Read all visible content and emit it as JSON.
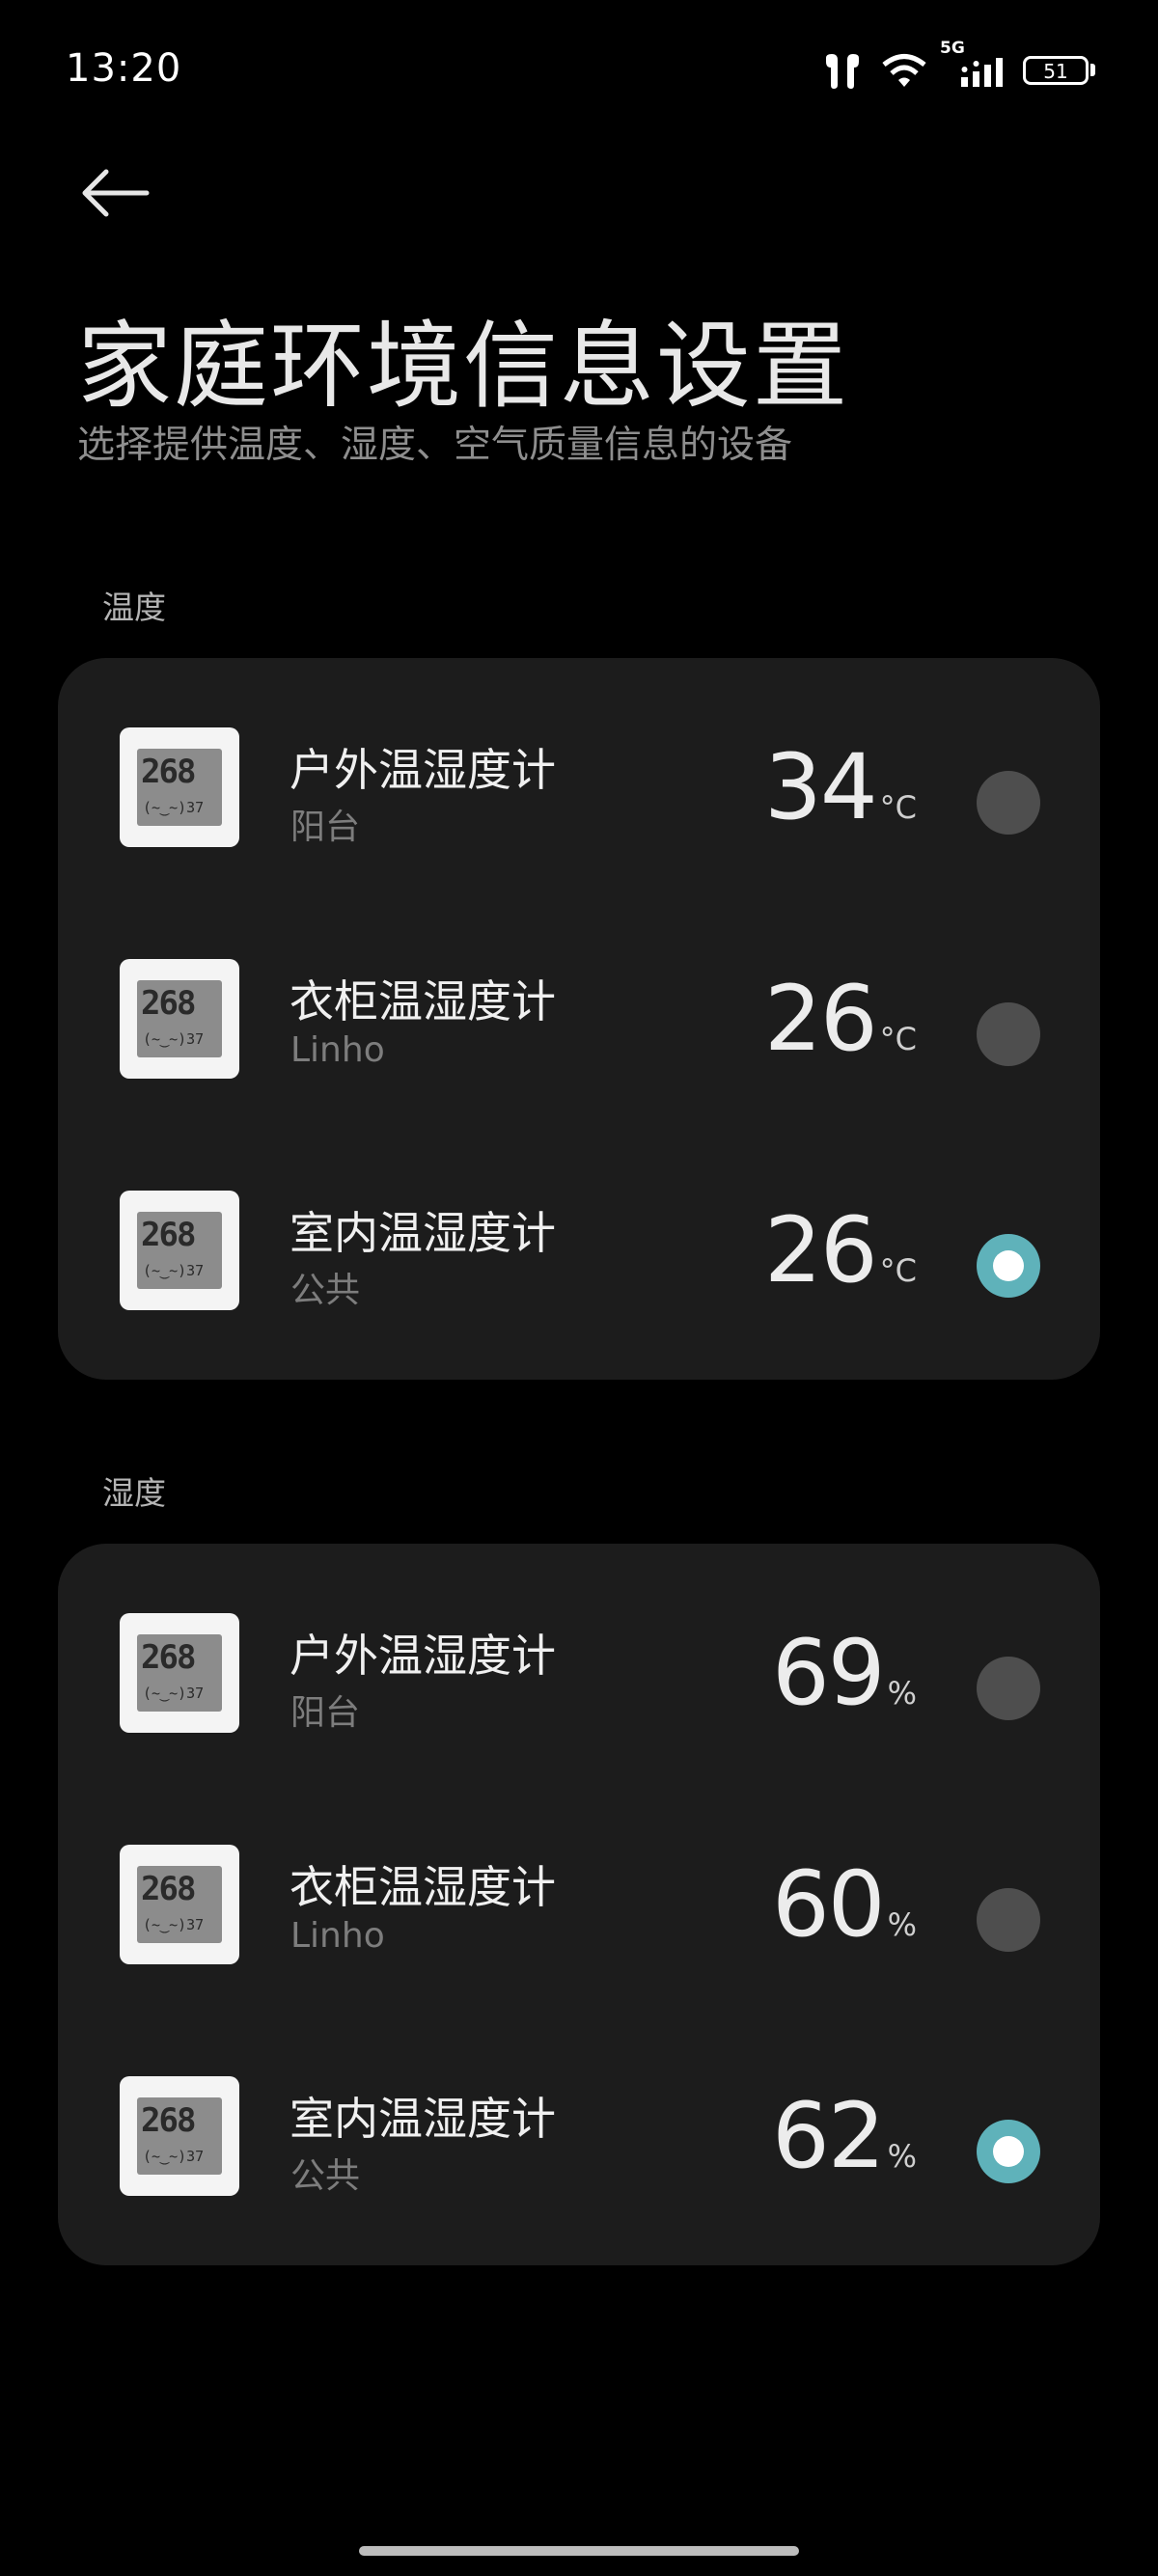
{
  "status_bar": {
    "time": "13:20",
    "network_label": "5G",
    "battery_level": "51"
  },
  "header": {
    "back_icon": "arrow-left-icon",
    "title": "家庭环境信息设置",
    "subtitle": "选择提供温度、湿度、空气质量信息的设备"
  },
  "device_display": {
    "big": "268",
    "small": "(~‿~)37"
  },
  "temperature_section": {
    "label": "温度",
    "unit": "°C",
    "devices": [
      {
        "name": "户外温湿度计",
        "room": "阳台",
        "value": "34",
        "selected": false
      },
      {
        "name": "衣柜温湿度计",
        "room": "Linho",
        "value": "26",
        "selected": false
      },
      {
        "name": "室内温湿度计",
        "room": "公共",
        "value": "26",
        "selected": true
      }
    ]
  },
  "humidity_section": {
    "label": "湿度",
    "unit": "%",
    "devices": [
      {
        "name": "户外温湿度计",
        "room": "阳台",
        "value": "69",
        "selected": false
      },
      {
        "name": "衣柜温湿度计",
        "room": "Linho",
        "value": "60",
        "selected": false
      },
      {
        "name": "室内温湿度计",
        "room": "公共",
        "value": "62",
        "selected": true
      }
    ]
  },
  "colors": {
    "background": "#000000",
    "card": "#1c1c1c",
    "radio_selected": "#5fb2ba",
    "radio_unselected": "#4e4e4e"
  }
}
